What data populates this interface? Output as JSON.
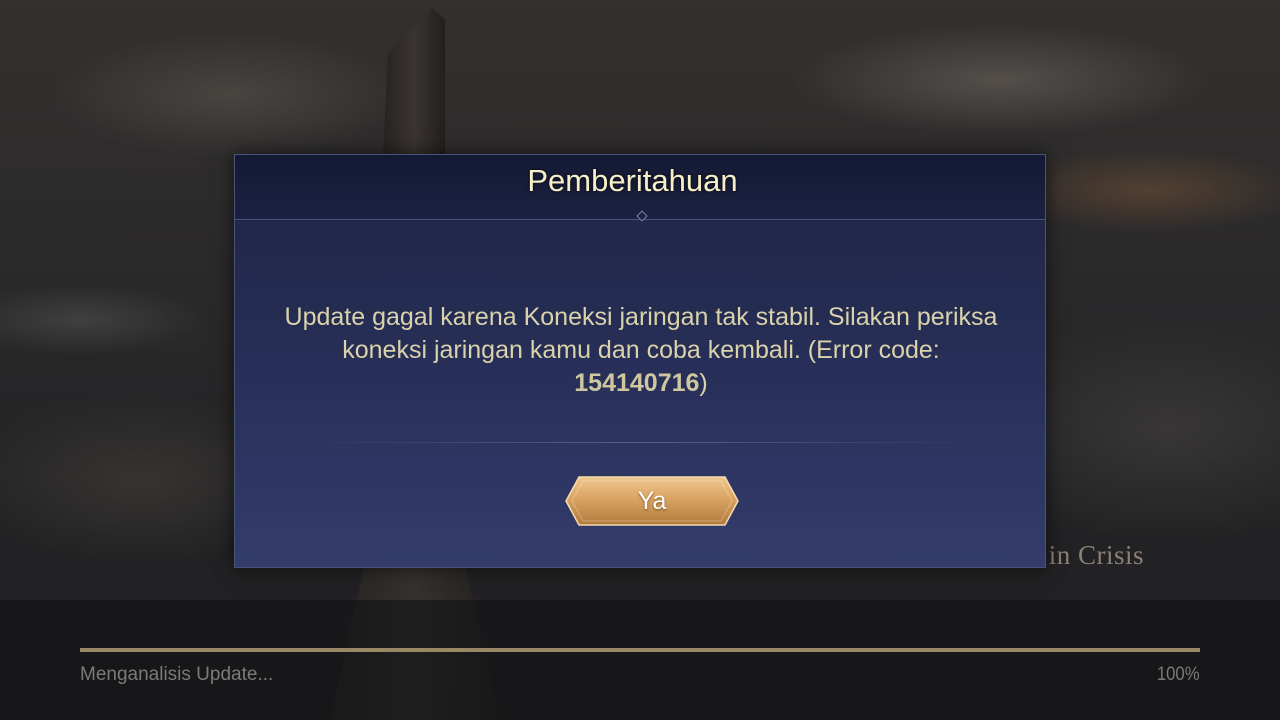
{
  "background": {
    "caption": "m in Crisis"
  },
  "dialog": {
    "title": "Pemberitahuan",
    "message": "Update gagal karena Koneksi jaringan tak stabil. Silakan periksa koneksi jaringan kamu dan coba kembali. (Error code: ",
    "error_code": "154140716",
    "message_end": ")",
    "confirm_label": "Ya"
  },
  "loading": {
    "status_text": "Menganalisis Update...",
    "percent_label": "100%",
    "progress": 1.0
  },
  "colors": {
    "title": "#f7efc8",
    "message": "#d9d2aa",
    "button_gold": "#d9a462",
    "progress_fill": "#9a8763"
  }
}
